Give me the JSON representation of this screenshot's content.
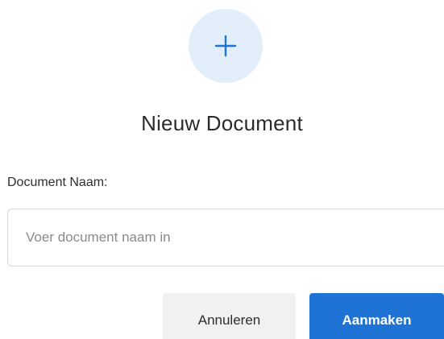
{
  "dialog": {
    "icon": "plus-icon",
    "title": "Nieuw Document",
    "field_label": "Document Naam:",
    "input": {
      "placeholder": "Voer document naam in",
      "value": ""
    },
    "cancel_label": "Annuleren",
    "create_label": "Aanmaken"
  },
  "colors": {
    "accent": "#1f73d4",
    "icon_circle_bg": "#e3eefb",
    "cancel_bg": "#f1f1f1"
  }
}
